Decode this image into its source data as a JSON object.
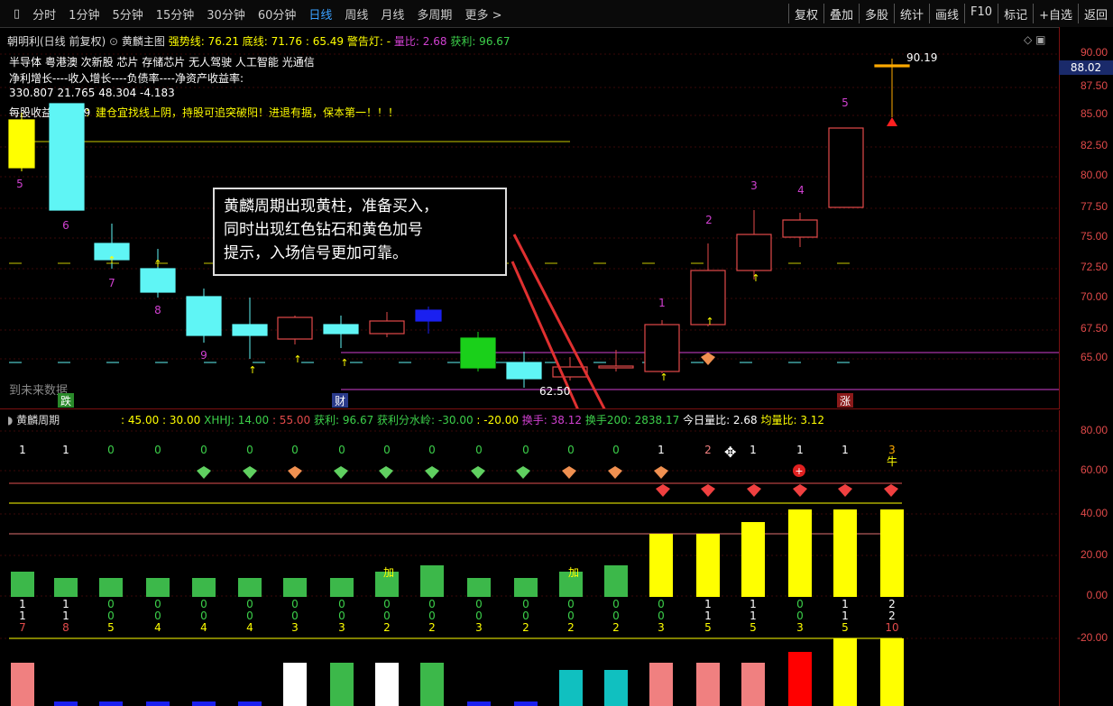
{
  "toolbar": {
    "tabs": [
      "分时",
      "1分钟",
      "5分钟",
      "15分钟",
      "30分钟",
      "60分钟",
      "日线",
      "周线",
      "月线",
      "多周期",
      "更多 >"
    ],
    "active": "日线",
    "right": [
      "复权",
      "叠加",
      "多股",
      "统计",
      "画线",
      "F10",
      "标记",
      "+自选",
      "返回"
    ]
  },
  "main_info": {
    "name": "朝明利(日线 前复权)",
    "indicator": "黄麟主图",
    "strong_line": "强势线: 76.21",
    "bottom_line": "底线: 71.76",
    "mid_value": ": 65.49",
    "warn": "警告灯: -",
    "vol_ratio": "量比: 2.68",
    "profit": "获利: 96.67",
    "concepts": "半导体  粤港澳 次新股 芯片 存储芯片 无人驾驶 人工智能 光通信",
    "growth_header": "净利增长----收入增长----负债率----净资产收益率:",
    "growth_values": "330.807 21.765   48.304   -4.183",
    "secret": "秘诀：建仓宜找线上阴，持股可追突破阳！进退有据，保本第一！！！",
    "eps": "每股收益: 0.859",
    "future": "到未来数据",
    "max_label": "90.19",
    "min_label": "62.50",
    "current_price": "88.02"
  },
  "main_axis": [
    "90.00",
    "87.50",
    "85.00",
    "82.50",
    "80.00",
    "77.50",
    "75.00",
    "72.50",
    "70.00",
    "67.50",
    "65.00"
  ],
  "popup_lines": [
    "黄麟周期出现黄柱，准备买入，",
    "同时出现红色钻石和黄色加号",
    "提示，入场信号更加可靠。"
  ],
  "candle_counts": [
    "5",
    "6",
    "7",
    "8",
    "9",
    "1",
    "2",
    "3",
    "4",
    "5"
  ],
  "markers": {
    "die": "跌",
    "cai": "财",
    "zhang": "涨"
  },
  "sub_info": {
    "name": "黄麟周期",
    "v1": ": 45.00",
    "v2": ": 30.00",
    "xhhj": "XHHJ: 14.00",
    "v3": ": 55.00",
    "profit": "获利: 96.67",
    "watershed": "获利分水岭: -30.00",
    "v4": ": -20.00",
    "turnover": "换手: 38.12",
    "turnover200": "换手200: 2838.17",
    "today_vol": "今日量比: 2.68",
    "avg_vol": "均量比: 3.12"
  },
  "sub_axis": [
    "80.00",
    "60.00",
    "40.00",
    "20.00",
    "0.00",
    "-20.00"
  ],
  "top_nums": [
    "1",
    "1",
    "0",
    "0",
    "0",
    "0",
    "0",
    "0",
    "0",
    "0",
    "0",
    "0",
    "0",
    "0",
    "1",
    "2",
    "1",
    "1",
    "1",
    "3"
  ],
  "bull_label": "牛",
  "add_labels": [
    "加",
    "加"
  ],
  "bottom_rows": {
    "r1": [
      "1",
      "1",
      "0",
      "0",
      "0",
      "0",
      "0",
      "0",
      "0",
      "0",
      "0",
      "0",
      "0",
      "0",
      "0",
      "1",
      "1",
      "0",
      "1",
      "2"
    ],
    "r2": [
      "1",
      "1",
      "0",
      "0",
      "0",
      "0",
      "0",
      "0",
      "0",
      "0",
      "0",
      "0",
      "0",
      "0",
      "0",
      "1",
      "1",
      "0",
      "1",
      "2"
    ],
    "r3": [
      "7",
      "8",
      "5",
      "4",
      "4",
      "4",
      "3",
      "3",
      "2",
      "2",
      "3",
      "2",
      "2",
      "2",
      "3",
      "5",
      "5",
      "3",
      "5",
      "10"
    ]
  },
  "colors": {
    "bg": "#000000",
    "red": "#e24a4a",
    "cyan": "#5ff5f5",
    "green": "#3cb84a",
    "yellow": "#ffff00",
    "magenta": "#d040d0"
  }
}
